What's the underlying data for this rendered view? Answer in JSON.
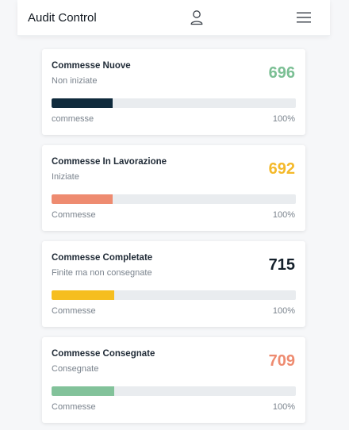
{
  "header": {
    "title": "Audit Control",
    "user_icon": "user-icon",
    "menu_icon": "hamburger-menu-icon"
  },
  "cards": [
    {
      "title": "Commesse Nuove",
      "subtitle": "Non iniziate",
      "value": "696",
      "value_color": "#7bbf94",
      "bar_color": "#0f2a3c",
      "bar_fraction": 0.25,
      "foot_left": "commesse",
      "foot_right": "100%"
    },
    {
      "title": "Commesse In Lavorazione",
      "subtitle": "Iniziate",
      "value": "692",
      "value_color": "#f4b92a",
      "bar_color": "#ee8b70",
      "bar_fraction": 0.25,
      "foot_left": "Commesse",
      "foot_right": "100%"
    },
    {
      "title": "Commesse Completate",
      "subtitle": "Finite ma non consegnate",
      "value": "715",
      "value_color": "#14202b",
      "bar_color": "#f6be1f",
      "bar_fraction": 0.255,
      "foot_left": "Commesse",
      "foot_right": "100%"
    },
    {
      "title": "Commesse Consegnate",
      "subtitle": "Consegnate",
      "value": "709",
      "value_color": "#ee8b70",
      "bar_color": "#82c29a",
      "bar_fraction": 0.255,
      "foot_left": "Commesse",
      "foot_right": "100%"
    }
  ]
}
